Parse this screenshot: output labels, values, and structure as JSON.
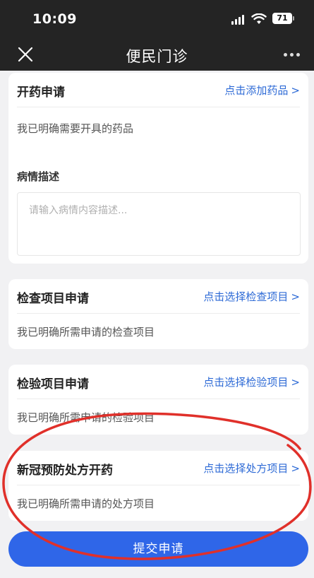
{
  "status_bar": {
    "time": "10:09",
    "battery": "71"
  },
  "nav": {
    "title": "便民门诊",
    "close_icon": "close-icon",
    "more_icon": "more-icon"
  },
  "medicine": {
    "title": "开药申请",
    "link": "点击添加药品",
    "desc": "我已明确需要开具的药品",
    "condition_label": "病情描述",
    "condition_placeholder": "请输入病情内容描述..."
  },
  "exam": {
    "title": "检查项目申请",
    "link": "点击选择检查项目",
    "desc": "我已明确所需申请的检查项目"
  },
  "lab": {
    "title": "检验项目申请",
    "link": "点击选择检验项目",
    "desc": "我已明确所需申请的检验项目"
  },
  "covid": {
    "title": "新冠预防处方开药",
    "link": "点击选择处方项目",
    "desc": "我已明确所需申请的处方项目"
  },
  "submit": {
    "label": "提交申请"
  },
  "colors": {
    "accent": "#2f66e8",
    "link": "#2d6ad6",
    "header": "#242424",
    "annotation": "#e0302a"
  }
}
